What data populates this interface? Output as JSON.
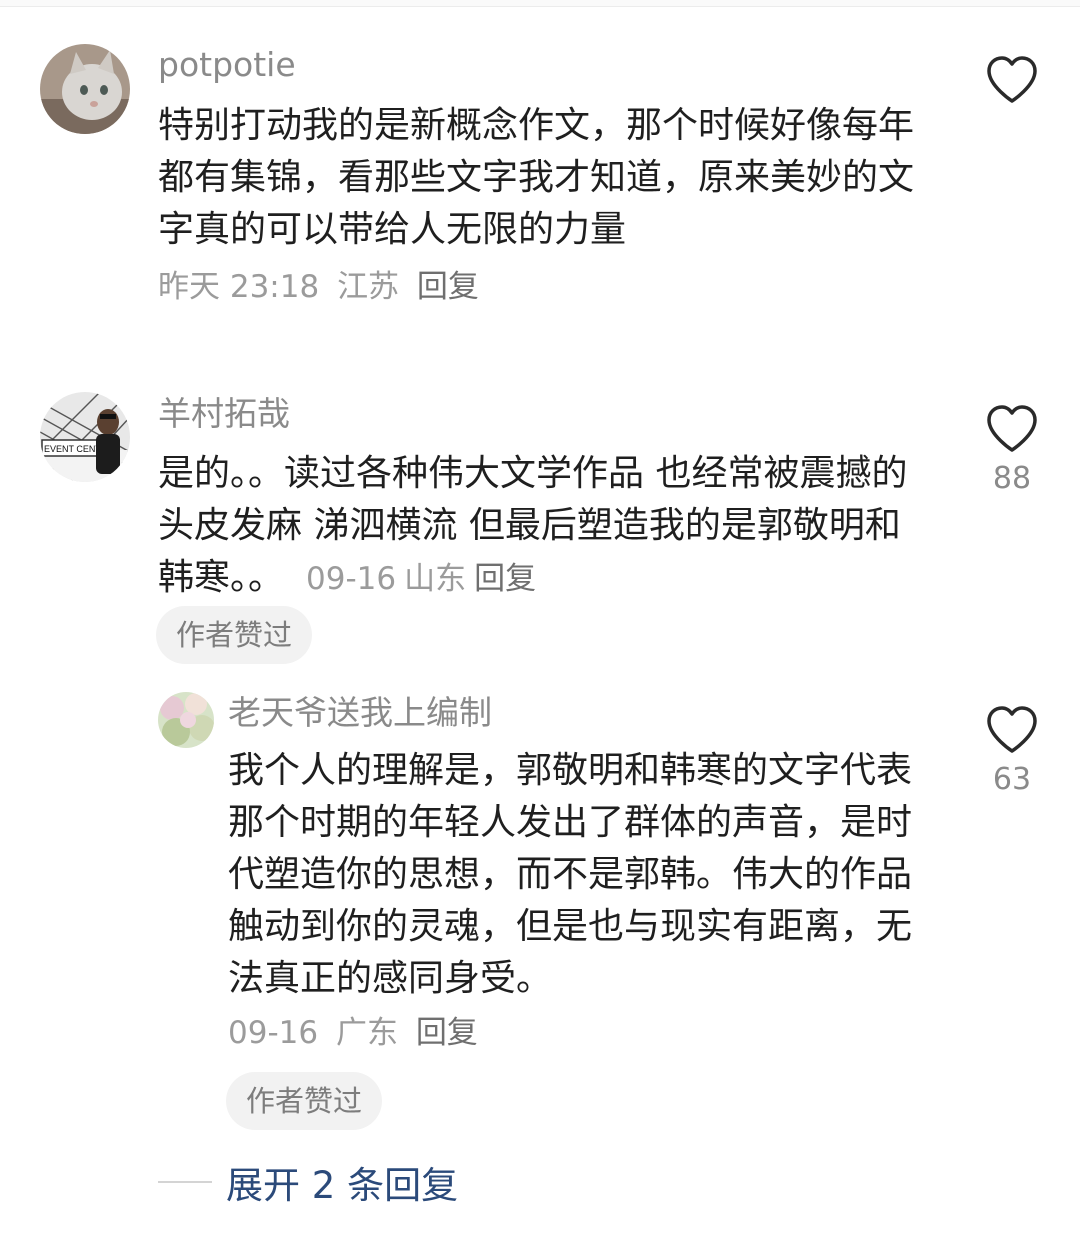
{
  "comments": [
    {
      "user": "potpotie",
      "text": "特别打动我的是新概念作文，那个时候好像每年都有集锦，看那些文字我才知道，原来美妙的文字真的可以带给人无限的力量",
      "time": "昨天 23:18",
      "location": "江苏",
      "reply_label": "回复",
      "like_count": ""
    },
    {
      "user": "羊村拓哉",
      "text": "是的。。读过各种伟大文学作品 也经常被震撼的头皮发麻 涕泗横流 但最后塑造我的是郭敬明和韩寒。。",
      "time": "09-16",
      "location": "山东",
      "reply_label": "回复",
      "badge": "作者赞过",
      "like_count": "88",
      "avatar_sign": "EVENT CENTER",
      "replies": [
        {
          "user": "老天爷送我上编制",
          "text": "我个人的理解是，郭敬明和韩寒的文字代表那个时期的年轻人发出了群体的声音，是时代塑造你的思想，而不是郭韩。伟大的作品触动到你的灵魂，但是也与现实有距离，无法真正的感同身受。",
          "time": "09-16",
          "location": "广东",
          "reply_label": "回复",
          "badge": "作者赞过",
          "like_count": "63"
        }
      ]
    }
  ],
  "expand_replies_label": "展开 2 条回复",
  "icons": {
    "like": "heart-outline-icon"
  },
  "colors": {
    "username": "#8a8a8a",
    "meta": "#9b9b9b",
    "badge_bg": "#f2f2f2",
    "expand_link": "#2b4a7a"
  }
}
